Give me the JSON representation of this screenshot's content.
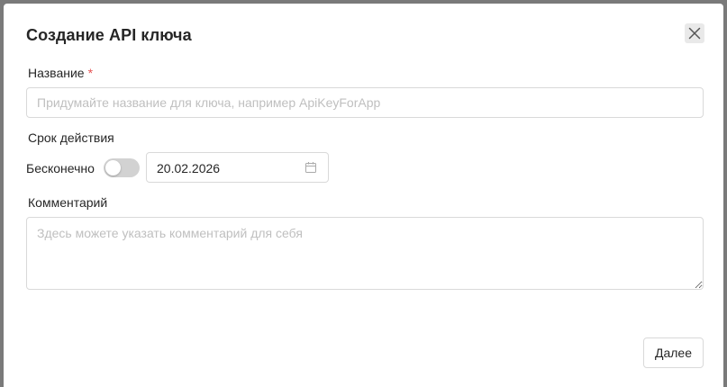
{
  "dialog": {
    "title": "Создание API ключа",
    "close_icon": "close-icon"
  },
  "form": {
    "name": {
      "label": "Название",
      "required_mark": "*",
      "value": "",
      "placeholder": "Придумайте название для ключа, например ApiKeyForApp"
    },
    "validity": {
      "label": "Срок действия",
      "infinite_label": "Бесконечно",
      "infinite_enabled": false,
      "date_value": "20.02.2026",
      "calendar_icon": "calendar-icon"
    },
    "comment": {
      "label": "Комментарий",
      "value": "",
      "placeholder": "Здесь можете указать комментарий для себя"
    }
  },
  "footer": {
    "next_label": "Далее"
  },
  "colors": {
    "required": "#e55353",
    "border": "#d9d9d9",
    "switch_off": "#d2d2d2",
    "close_bg": "#e9e9e9"
  }
}
